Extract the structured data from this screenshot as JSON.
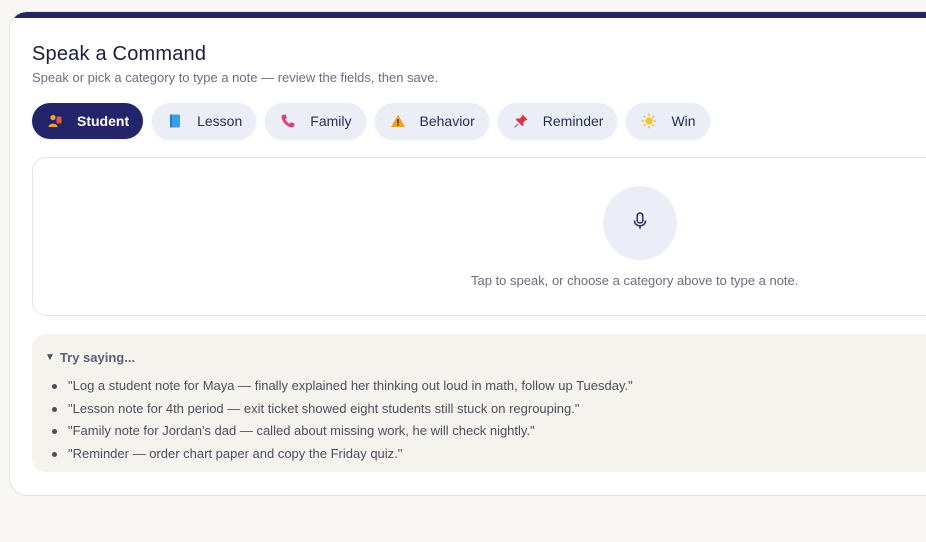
{
  "header": {
    "title": "Speak a Command",
    "subtitle": "Speak or pick a category to type a note — review the fields, then save."
  },
  "categories": [
    {
      "label": "Student",
      "icon": "student-icon",
      "active": true
    },
    {
      "label": "Lesson",
      "icon": "book-icon",
      "active": false
    },
    {
      "label": "Family",
      "icon": "phone-icon",
      "active": false
    },
    {
      "label": "Behavior",
      "icon": "warning-icon",
      "active": false
    },
    {
      "label": "Reminder",
      "icon": "pin-icon",
      "active": false
    },
    {
      "label": "Win",
      "icon": "sun-icon",
      "active": false
    }
  ],
  "voice": {
    "mic_icon": "microphone-icon",
    "hint": "Tap to speak, or choose a category above to type a note."
  },
  "examples": {
    "toggle_label": "Try saying...",
    "items": [
      "\"Log a student note for Maya — finally explained her thinking out loud in math, follow up Tuesday.\"",
      "\"Lesson note for 4th period — exit ticket showed eight students still stuck on regrouping.\"",
      "\"Family note for Jordan's dad — called about missing work, he will check nightly.\"",
      "\"Reminder — order chart paper and copy the Friday quiz.\""
    ]
  },
  "colors": {
    "accent": "#23246a",
    "chip_bg": "#eceef7",
    "examples_bg": "#f4f3ee",
    "page_bg": "#f8f7f3"
  }
}
